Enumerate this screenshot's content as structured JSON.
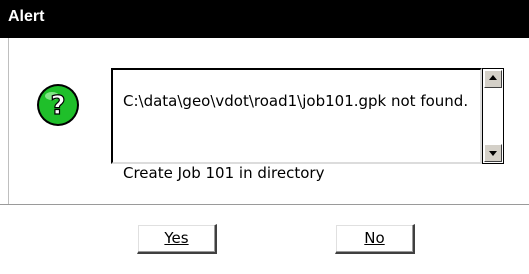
{
  "window": {
    "title": "Alert"
  },
  "message": {
    "line1": "C:\\data\\geo\\vdot\\road1\\job101.gpk not found.",
    "line2": "Create Job 101 in directory"
  },
  "buttons": {
    "yes_label": "Yes",
    "no_label": "No"
  },
  "icon": {
    "name": "question-icon",
    "color": "#1fbf2a"
  },
  "colors": {
    "titlebar": "#000000",
    "titletext": "#ffffff"
  }
}
